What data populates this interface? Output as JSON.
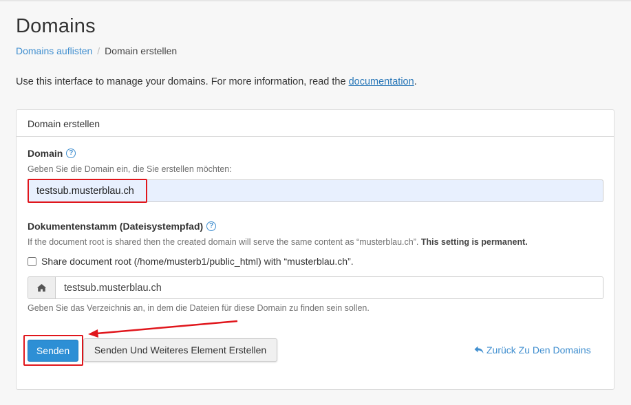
{
  "page": {
    "title": "Domains",
    "breadcrumb": {
      "link": "Domains auflisten",
      "separator": "/",
      "current": "Domain erstellen"
    },
    "intro_text": "Use this interface to manage your domains. For more information, read the ",
    "intro_link": "documentation",
    "intro_end": "."
  },
  "panel": {
    "heading": "Domain erstellen",
    "domain": {
      "label": "Domain",
      "help_icon": "question-circle-icon",
      "hint": "Geben Sie die Domain ein, die Sie erstellen möchten:",
      "value": "testsub.musterblau.ch"
    },
    "docroot": {
      "label": "Dokumentenstamm (Dateisystempfad)",
      "help_icon": "question-circle-icon",
      "hint": "If the document root is shared then the created domain will serve the same content as “musterblau.ch”.",
      "hint_bold": "This setting is permanent.",
      "checkbox_label": "Share document root (/home/musterb1/public_html) with “musterblau.ch”.",
      "checkbox_checked": false,
      "addon_icon": "home-icon",
      "value": "testsub.musterblau.ch",
      "help": "Geben Sie das Verzeichnis an, in dem die Dateien für diese Domain zu finden sein sollen."
    },
    "actions": {
      "submit": "Senden",
      "submit_more": "Senden Und Weiteres Element Erstellen",
      "back": "Zurück Zu Den Domains",
      "back_icon": "reply-icon"
    }
  },
  "colors": {
    "accent": "#2d8fd5",
    "link": "#3f8ecf",
    "highlight": "#e0161c",
    "autofill": "#e8f0fe"
  }
}
